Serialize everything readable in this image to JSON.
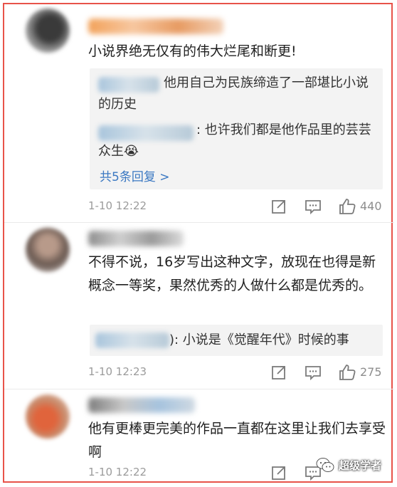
{
  "comments": [
    {
      "text": "小说界绝无仅有的伟大烂尾和断更!",
      "replies": [
        {
          "text": "他用自己为民族缔造了一部堪比小说的历史"
        },
        {
          "text": ": 也许我们都是他作品里的芸芸众生😭"
        }
      ],
      "more_replies": "共5条回复 >",
      "time": "1-10 12:22",
      "likes": "440"
    },
    {
      "text": "不得不说，16岁写出这种文字，放现在也得是新概念一等奖，果然优秀的人做什么都是优秀的。",
      "replies": [
        {
          "text": "): 小说是《觉醒年代》时候的事"
        }
      ],
      "time": "1-10 12:23",
      "likes": "275"
    },
    {
      "text": "他有更棒更完美的作品一直都在这里让我们去享受啊",
      "time": "1-10 12:22"
    }
  ],
  "watermark": "超级学者",
  "icons": {
    "repost": "repost-icon",
    "comment": "comment-icon",
    "like": "thumbs-up-icon",
    "watermark": "wechat-icon"
  }
}
